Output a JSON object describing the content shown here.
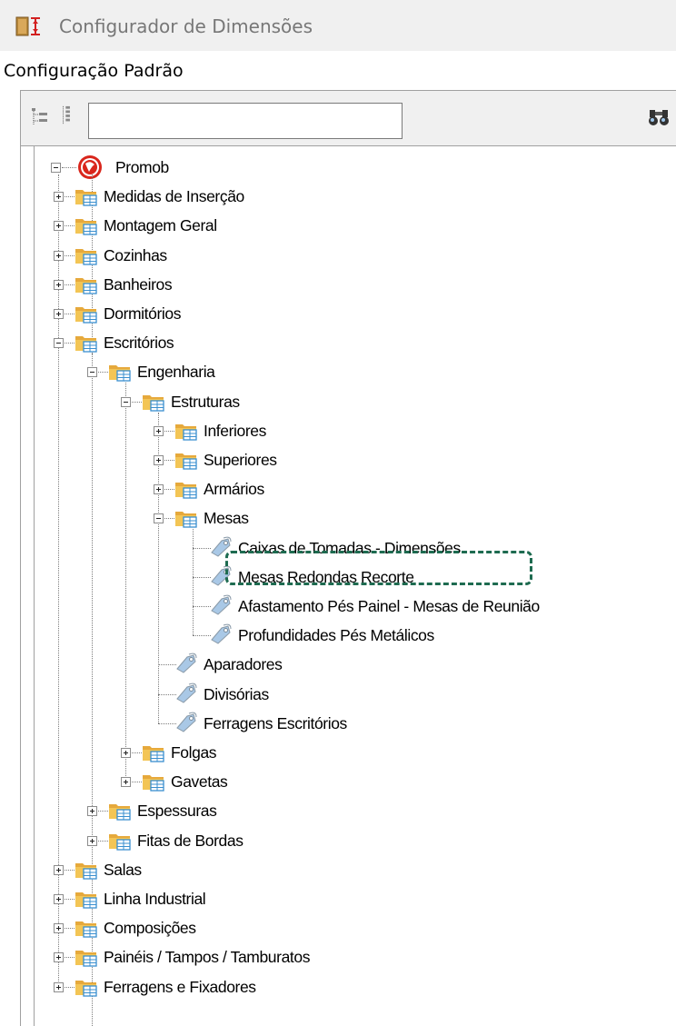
{
  "window": {
    "title": "Configurador de Dimensões",
    "app_icon": "dimension-configurator-icon"
  },
  "section_label": "Configuração Padrão",
  "toolbar": {
    "expand_icon": "expand-all-icon",
    "collapse_icon": "collapse-all-icon",
    "search_value": "",
    "search_icon": "binoculars-search-icon"
  },
  "tree": {
    "root": "Promob",
    "nodes": [
      {
        "label": "Medidas de Inserção",
        "type": "folder",
        "state": "collapsed"
      },
      {
        "label": "Montagem Geral",
        "type": "folder",
        "state": "collapsed"
      },
      {
        "label": "Cozinhas",
        "type": "folder",
        "state": "collapsed"
      },
      {
        "label": "Banheiros",
        "type": "folder",
        "state": "collapsed"
      },
      {
        "label": "Dormitórios",
        "type": "folder",
        "state": "collapsed"
      },
      {
        "label": "Escritórios",
        "type": "folder",
        "state": "expanded"
      },
      {
        "label": "Engenharia",
        "type": "folder",
        "state": "expanded"
      },
      {
        "label": "Estruturas",
        "type": "folder",
        "state": "expanded"
      },
      {
        "label": "Inferiores",
        "type": "folder",
        "state": "collapsed"
      },
      {
        "label": "Superiores",
        "type": "folder",
        "state": "collapsed"
      },
      {
        "label": "Armários",
        "type": "folder",
        "state": "collapsed"
      },
      {
        "label": "Mesas",
        "type": "folder",
        "state": "expanded"
      },
      {
        "label": "Caixas de Tomadas - Dimensões",
        "type": "item"
      },
      {
        "label": "Mesas Redondas Recorte",
        "type": "item",
        "highlighted": true
      },
      {
        "label": "Afastamento Pés Painel - Mesas de Reunião",
        "type": "item"
      },
      {
        "label": "Profundidades Pés Metálicos",
        "type": "item"
      },
      {
        "label": "Aparadores",
        "type": "item"
      },
      {
        "label": "Divisórias",
        "type": "item"
      },
      {
        "label": "Ferragens Escritórios",
        "type": "item"
      },
      {
        "label": "Folgas",
        "type": "folder",
        "state": "collapsed"
      },
      {
        "label": "Gavetas",
        "type": "folder",
        "state": "collapsed"
      },
      {
        "label": "Espessuras",
        "type": "folder",
        "state": "collapsed"
      },
      {
        "label": "Fitas de Bordas",
        "type": "folder",
        "state": "collapsed"
      },
      {
        "label": "Salas",
        "type": "folder",
        "state": "collapsed"
      },
      {
        "label": "Linha Industrial",
        "type": "folder",
        "state": "collapsed"
      },
      {
        "label": "Composições",
        "type": "folder",
        "state": "collapsed"
      },
      {
        "label": "Painéis / Tampos / Tamburatos",
        "type": "folder",
        "state": "collapsed"
      },
      {
        "label": "Ferragens e Fixadores",
        "type": "folder",
        "state": "collapsed"
      }
    ]
  },
  "colors": {
    "folder": "#f3c555",
    "folder_tab": "#e6a93c",
    "grid_blue": "#3a8fcf",
    "root_red": "#d9261c",
    "highlight_border": "#1e6b50",
    "tag_fill": "#a9c8e6"
  }
}
